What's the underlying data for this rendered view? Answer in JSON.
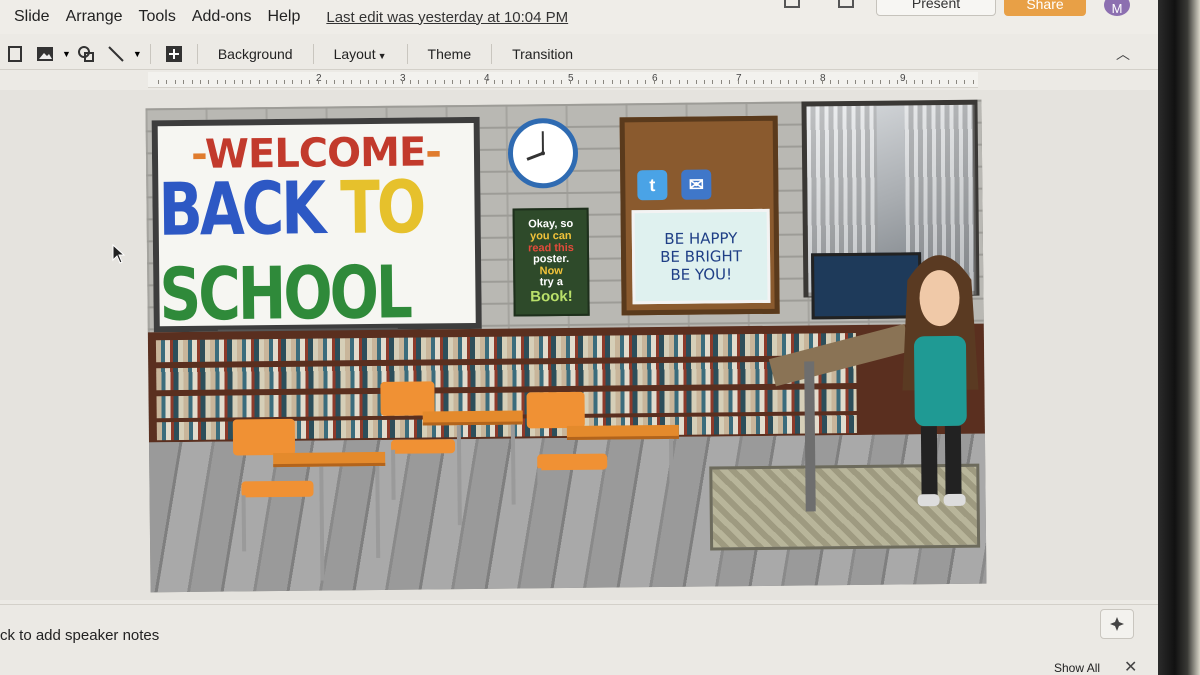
{
  "menu": {
    "items": [
      "Slide",
      "Arrange",
      "Tools",
      "Add-ons",
      "Help"
    ],
    "last_edit": "Last edit was yesterday at 10:04 PM"
  },
  "header": {
    "present_label": "Present",
    "share_label": "Share",
    "avatar_initial": "M"
  },
  "toolbar": {
    "background_label": "Background",
    "layout_label": "Layout",
    "theme_label": "Theme",
    "transition_label": "Transition"
  },
  "ruler": {
    "numbers": [
      "2",
      "3",
      "4",
      "5",
      "6",
      "7",
      "8",
      "9"
    ]
  },
  "slide": {
    "whiteboard": {
      "line1": "WELCOME",
      "word_back": "BACK",
      "word_to": "TO",
      "word_school": "SCHOOL"
    },
    "poster": {
      "line1": "Okay, so",
      "line2": "you can",
      "line3": "read this",
      "line4": "poster.",
      "line5": "Now",
      "line6": "try a",
      "line7": "Book!"
    },
    "card": {
      "line1": "BE HAPPY",
      "line2": "BE BRIGHT",
      "line3": "BE YOU!"
    }
  },
  "notes": {
    "placeholder": "ck to add speaker notes",
    "show_all_label": "Show All"
  },
  "colors": {
    "share_orange": "#e8a046",
    "avatar_purple": "#8c6fb0"
  }
}
